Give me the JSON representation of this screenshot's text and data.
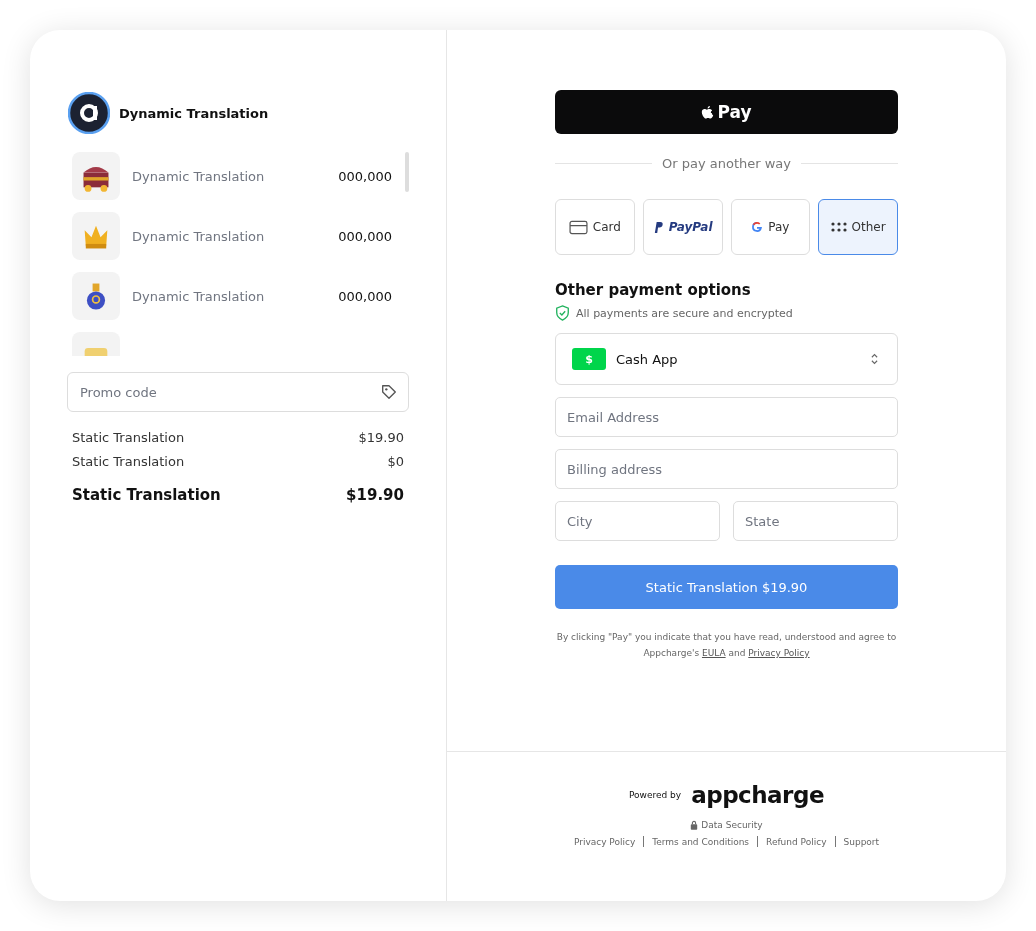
{
  "store": {
    "name": "Dynamic Translation"
  },
  "items": [
    {
      "kind": "chest",
      "name": "Dynamic Translation",
      "amount": "000,000"
    },
    {
      "kind": "crown",
      "name": "Dynamic Translation",
      "amount": "000,000"
    },
    {
      "kind": "potion",
      "name": "Dynamic Translation",
      "amount": "000,000"
    },
    {
      "kind": "scroll"
    }
  ],
  "promo": {
    "placeholder": "Promo code"
  },
  "summary": [
    {
      "label": "Static Translation",
      "value": "$19.90",
      "kind": "line"
    },
    {
      "label": "Static Translation",
      "value": "$0",
      "kind": "line"
    },
    {
      "label": "Static Translation",
      "value": "$19.90",
      "kind": "total"
    }
  ],
  "apple_pay": {
    "label": "Pay"
  },
  "divider_text": "Or pay another way",
  "methods": [
    {
      "kind": "card",
      "label": "Card",
      "selected": false
    },
    {
      "kind": "paypal",
      "label": "PayPal",
      "selected": false
    },
    {
      "kind": "gpay",
      "label": "Pay",
      "selected": false
    },
    {
      "kind": "other",
      "label": "Other",
      "selected": true
    }
  ],
  "options_title": "Other payment options",
  "secure_note": "All payments are secure and encrypted",
  "provider": {
    "label": "Cash App",
    "badge": "$"
  },
  "fields": [
    {
      "placeholder": "Email Address"
    },
    {
      "placeholder": "Billing address"
    }
  ],
  "city_state": [
    {
      "placeholder": "City"
    },
    {
      "placeholder": "State"
    }
  ],
  "pay_button": "Static Translation $19.90",
  "legal": {
    "text": "By clicking \"Pay\" you indicate that you have read, understood and agree to Appcharge's",
    "eula": "EULA",
    "and": "and",
    "privacy": "Privacy Policy"
  },
  "footer": {
    "powered_by": "Powered by",
    "brand": "appcharge",
    "security": "Data Security",
    "links": [
      "Privacy Policy",
      "Terms and Conditions",
      "Refund Policy",
      "Support"
    ]
  }
}
